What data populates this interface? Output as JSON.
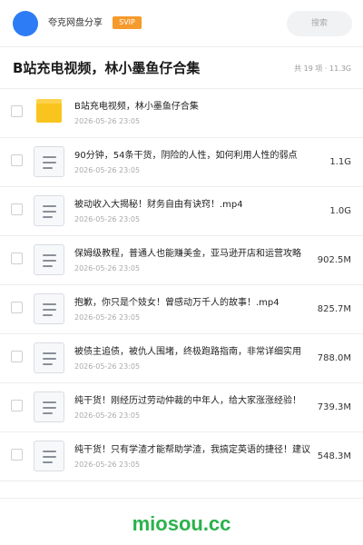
{
  "header": {
    "share_name": "夸克网盘分享",
    "badge": "SVIP",
    "search_placeholder": "搜索"
  },
  "title": "B站充电视频，林小墨鱼仔合集",
  "summary": "共 19 项 · 11.3G",
  "files": [
    {
      "type": "folder",
      "name": "B站充电视频，林小墨鱼仔合集",
      "date": "2026-05-26 23:05",
      "size": ""
    },
    {
      "type": "file",
      "name": "90分钟，54条干货，阴险的人性，如何利用人性的弱点",
      "date": "2026-05-26 23:05",
      "size": "1.1G"
    },
    {
      "type": "file",
      "name": "被动收入大揭秘！财务自由有诀窍！.mp4",
      "date": "2026-05-26 23:05",
      "size": "1.0G"
    },
    {
      "type": "file",
      "name": "保姆级教程，普通人也能赚美金，亚马逊开店和运营攻略",
      "date": "2026-05-26 23:05",
      "size": "902.5M"
    },
    {
      "type": "file",
      "name": "抱歉，你只是个妓女！曾感动万千人的故事！.mp4",
      "date": "2026-05-26 23:05",
      "size": "825.7M"
    },
    {
      "type": "file",
      "name": "被债主追债，被仇人围堵，终极跑路指南，非常详细实用",
      "date": "2026-05-26 23:05",
      "size": "788.0M"
    },
    {
      "type": "file",
      "name": "纯干货！刚经历过劳动仲裁的中年人，给大家涨涨经验！",
      "date": "2026-05-26 23:05",
      "size": "739.3M"
    },
    {
      "type": "file",
      "name": "纯干货！只有学渣才能帮助学渣，我搞定英语的捷径！建议",
      "date": "2026-05-26 23:05",
      "size": "548.3M"
    }
  ],
  "watermark": "miosou.cc",
  "colors": {
    "accent": "#2d7cf6",
    "badge": "#f59a2c",
    "folder": "#f9c41d",
    "watermark": "#2bb24c"
  }
}
